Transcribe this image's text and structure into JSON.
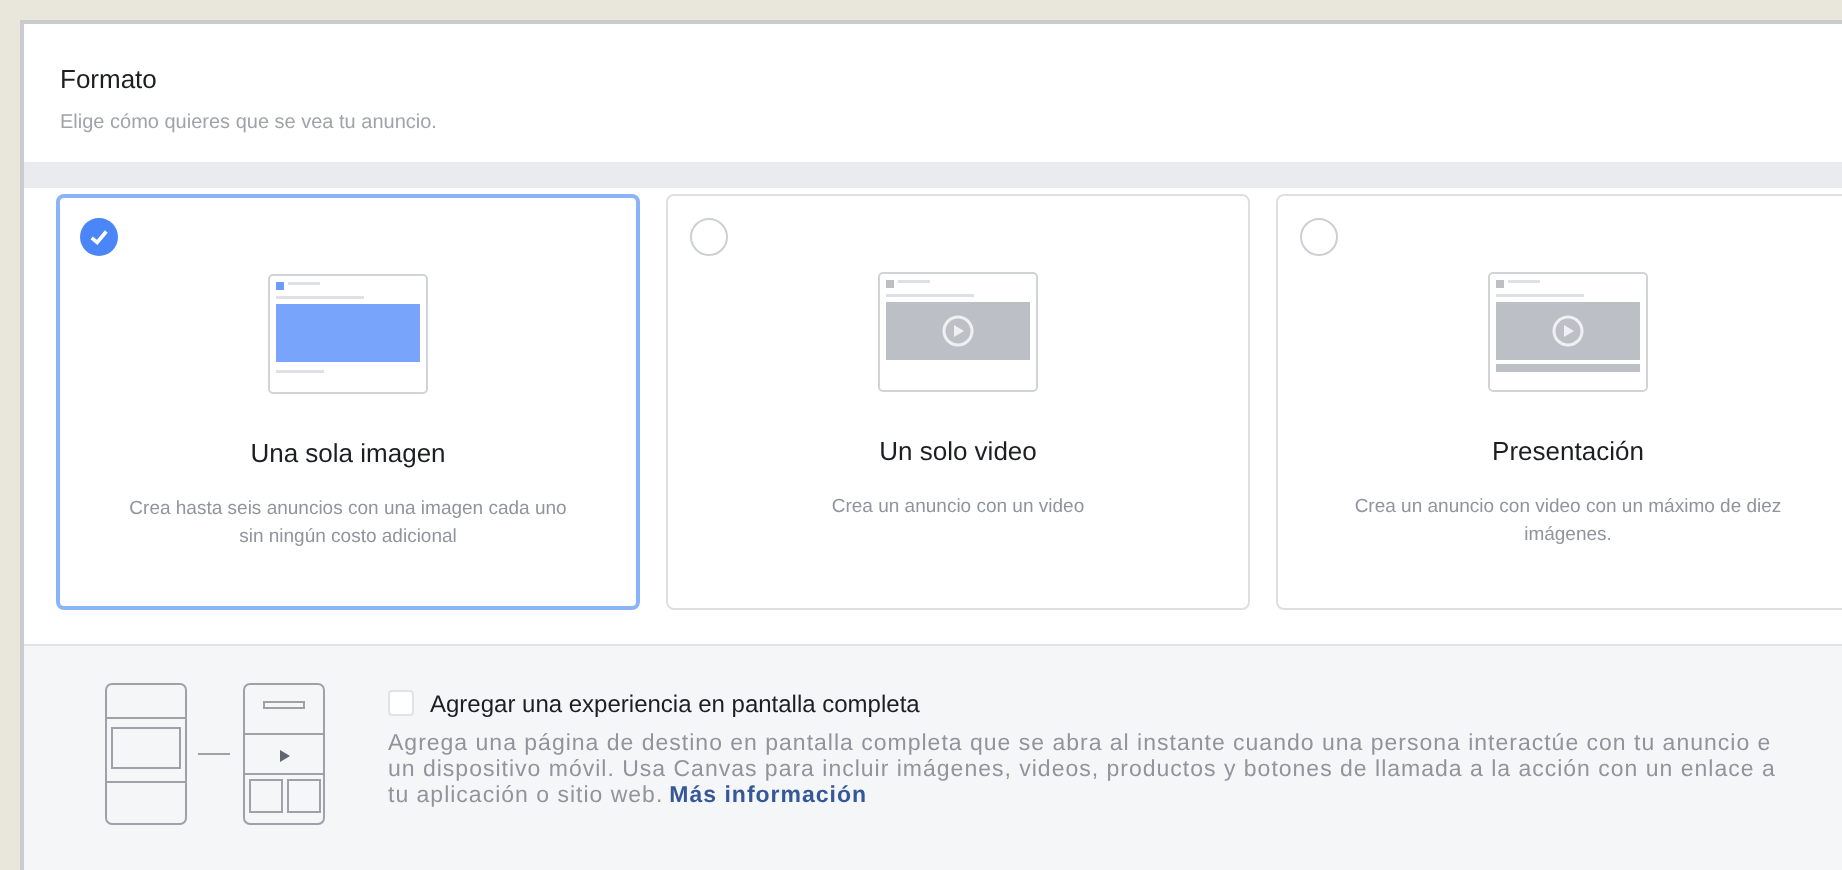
{
  "section": {
    "title": "Formato",
    "subtitle": "Elige cómo quieres que se vea tu anuncio."
  },
  "formats": [
    {
      "kind": "image",
      "title": "Una sola imagen",
      "description": "Crea hasta seis anuncios con una imagen cada uno sin ningún costo adicional",
      "selected": true
    },
    {
      "kind": "video",
      "title": "Un solo video",
      "description": "Crea un anuncio con un video",
      "selected": false
    },
    {
      "kind": "slideshow",
      "title": "Presentación",
      "description": "Crea un anuncio con video con un máximo de diez imágenes.",
      "selected": false
    }
  ],
  "fullscreen": {
    "label": "Agregar una experiencia en pantalla completa",
    "checked": false,
    "description_lines": [
      "Agrega una página de destino en pantalla completa que se abra al instante cuando una persona interactúe con tu anuncio e",
      "un dispositivo móvil. Usa Canvas para incluir imágenes, videos, productos y botones de llamada a la acción con un enlace a",
      "tu aplicación o sitio web."
    ],
    "link": "Más información"
  }
}
